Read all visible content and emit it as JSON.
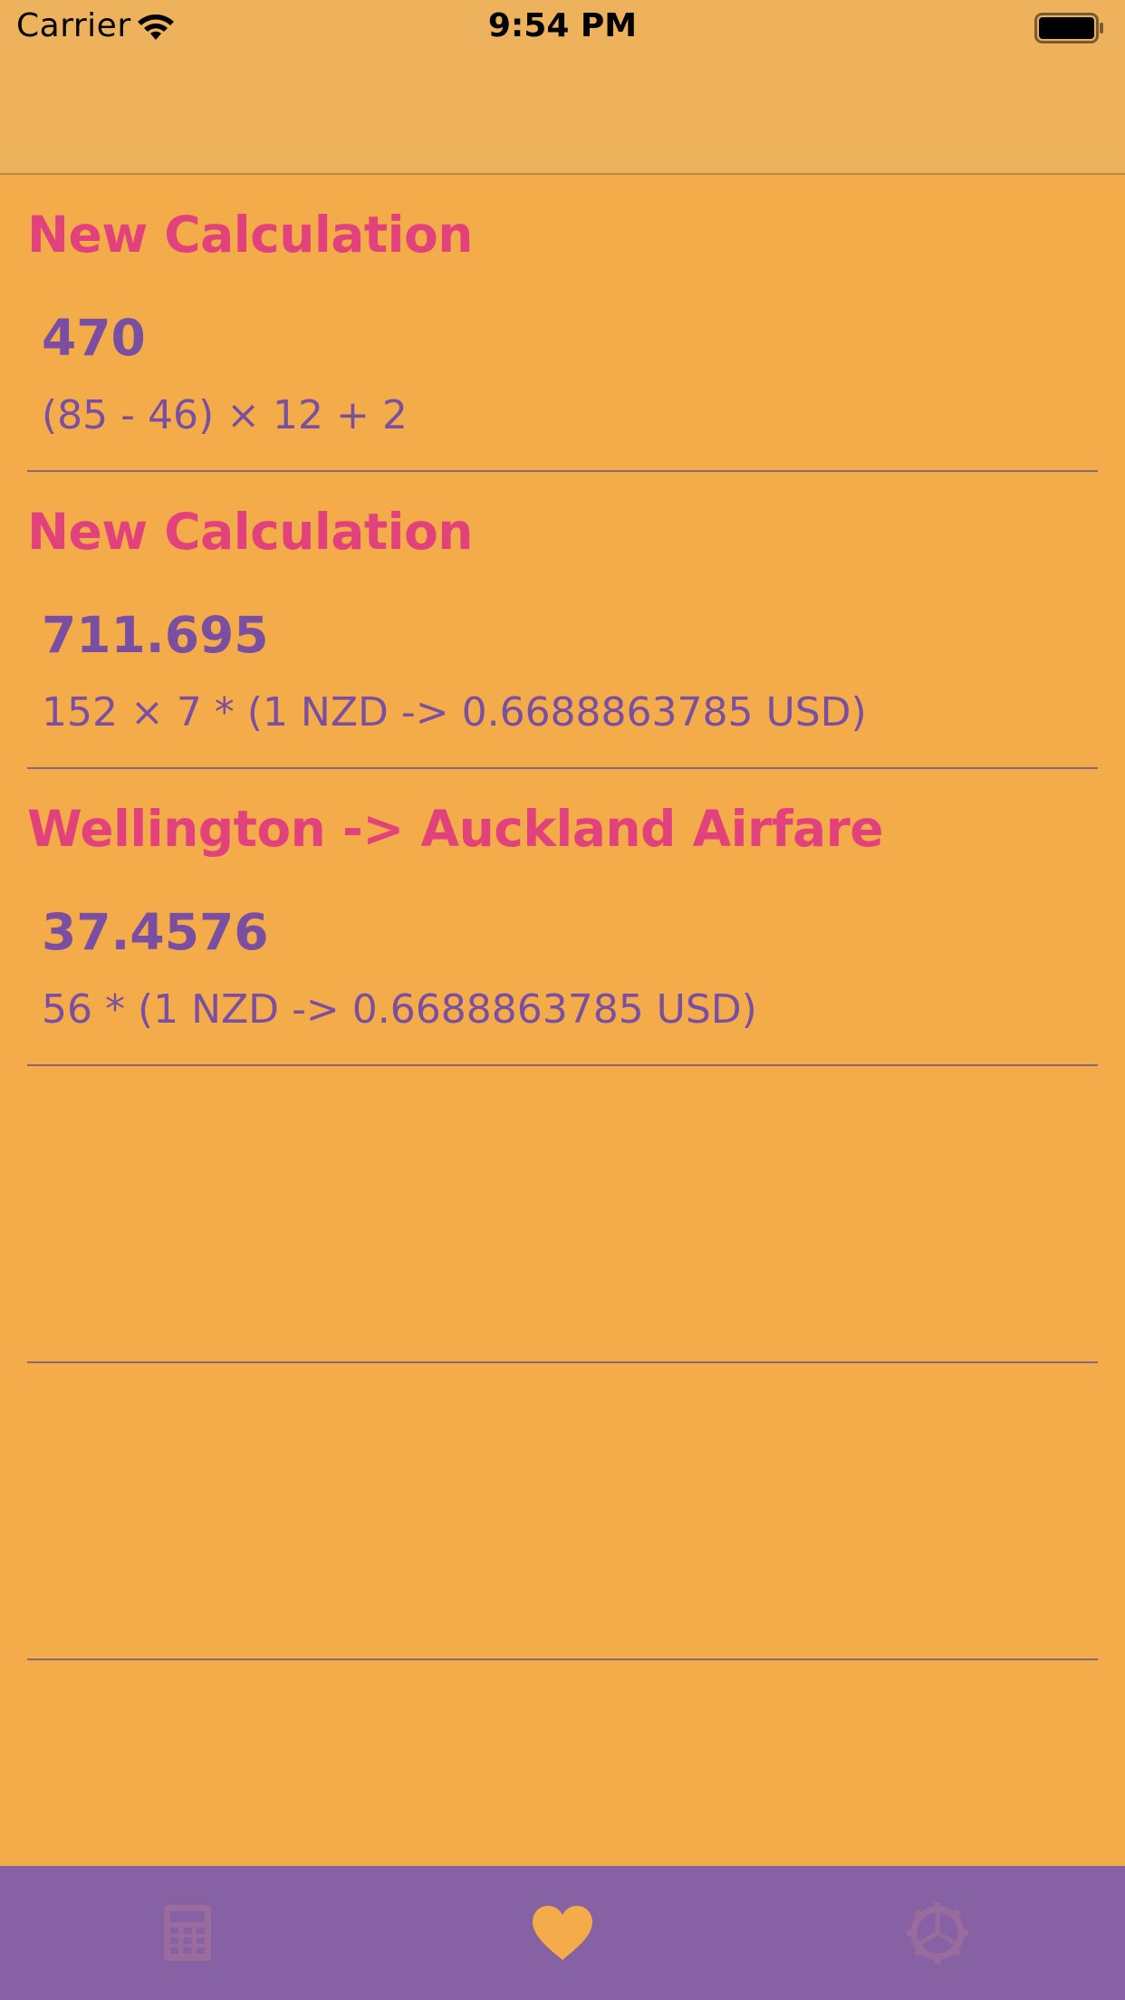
{
  "status_bar": {
    "carrier": "Carrier",
    "time": "9:54 PM",
    "wifi_icon": "wifi-icon",
    "battery_icon": "battery-icon"
  },
  "calculations": [
    {
      "title": "New Calculation",
      "result": "470",
      "expression": "(85 - 46) × 12 + 2"
    },
    {
      "title": "New Calculation",
      "result": "711.695",
      "expression": "152 × 7 * (1 NZD -> 0.6688863785 USD)"
    },
    {
      "title": "Wellington -> Auckland Airfare",
      "result": "37.4576",
      "expression": "56 * (1 NZD -> 0.6688863785 USD)"
    },
    {
      "title": "",
      "result": "",
      "expression": ""
    },
    {
      "title": "",
      "result": "",
      "expression": ""
    }
  ],
  "tab_bar": {
    "tabs": [
      {
        "icon": "calculator-icon",
        "selected": false
      },
      {
        "icon": "heart-icon",
        "selected": true
      },
      {
        "icon": "gear-icon",
        "selected": false
      }
    ],
    "colors": {
      "background": "#8661A4",
      "selected": "#F3AC49",
      "unselected": "#9A6C9E"
    }
  },
  "colors": {
    "background": "#F3AC49",
    "nav_background": "#EEB25C",
    "title": "#E2427B",
    "text": "#7A4FA1"
  }
}
